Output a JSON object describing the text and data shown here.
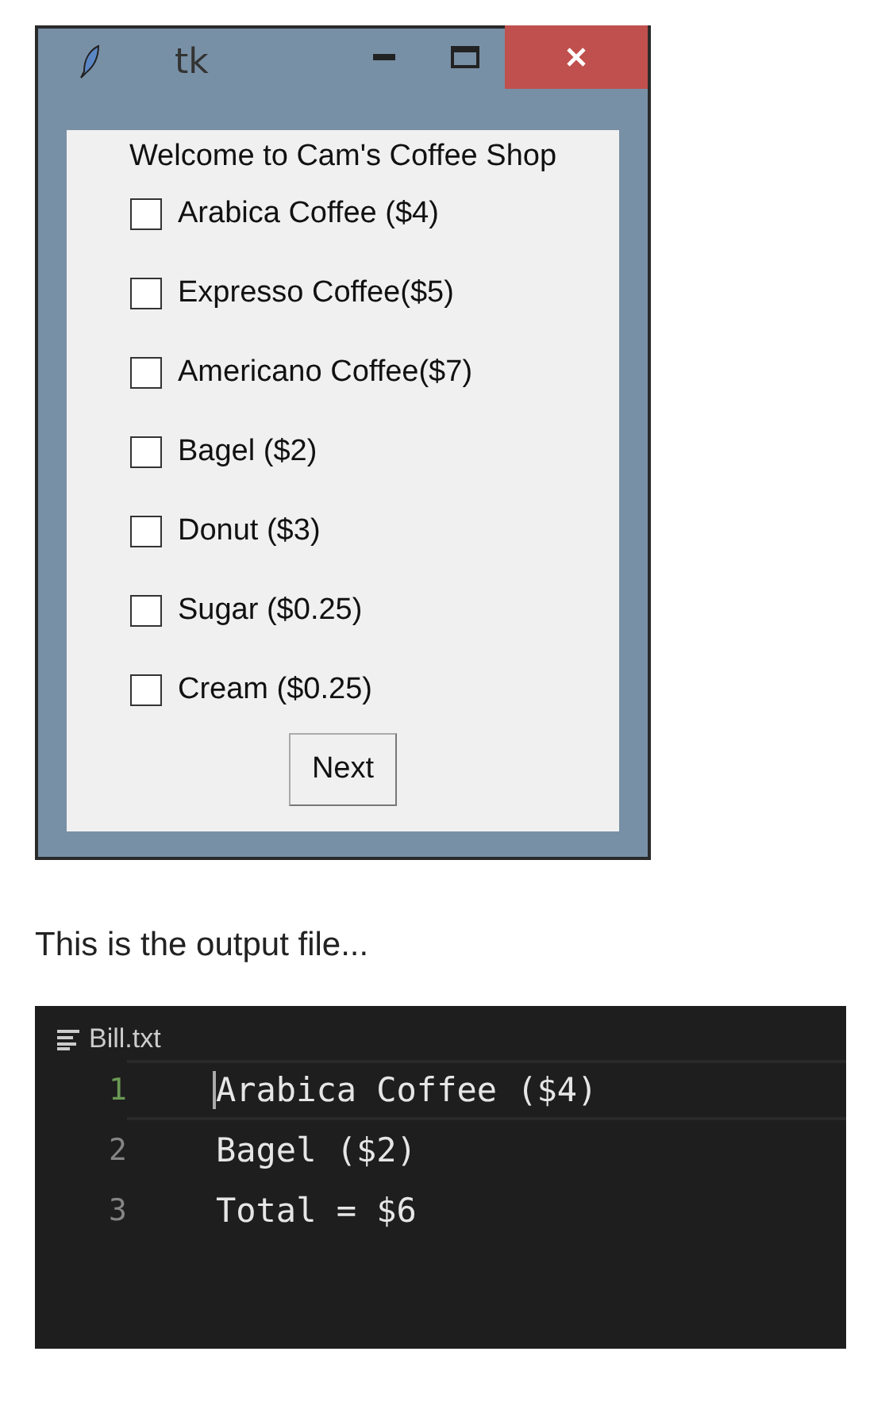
{
  "window": {
    "title": "tk",
    "heading": "Welcome to Cam's Coffee Shop",
    "items": [
      {
        "label": "Arabica Coffee ($4)",
        "checked": false
      },
      {
        "label": "Expresso Coffee($5)",
        "checked": false
      },
      {
        "label": "Americano Coffee($7)",
        "checked": false
      },
      {
        "label": "Bagel ($2)",
        "checked": false
      },
      {
        "label": "Donut ($3)",
        "checked": false
      },
      {
        "label": "Sugar ($0.25)",
        "checked": false
      },
      {
        "label": "Cream ($0.25)",
        "checked": false
      }
    ],
    "button": "Next"
  },
  "caption": "This is the output file...",
  "editor": {
    "tab": "Bill.txt",
    "lines": [
      {
        "number": "1",
        "text": "Arabica Coffee ($4)",
        "selected": true
      },
      {
        "number": "2",
        "text": "Bagel ($2)",
        "selected": false
      },
      {
        "number": "3",
        "text": "Total = $6",
        "selected": false
      }
    ]
  }
}
